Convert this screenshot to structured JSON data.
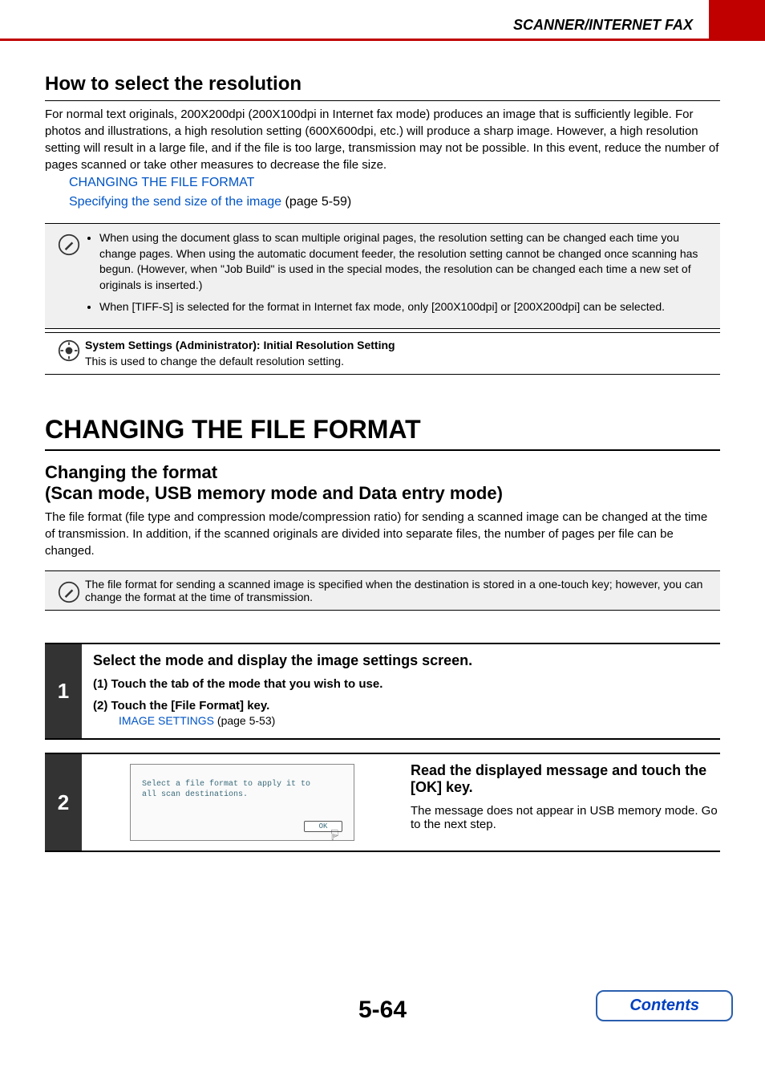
{
  "header": {
    "title": "SCANNER/INTERNET FAX"
  },
  "section1": {
    "heading": "How to select the resolution",
    "body": "For normal text originals, 200X200dpi (200X100dpi in Internet fax mode) produces an image that is sufficiently legible. For photos and illustrations, a high resolution setting (600X600dpi, etc.) will produce a sharp image. However, a high resolution setting will result in a large file, and if the file is too large, transmission may not be possible. In this event, reduce the number of pages scanned or take other measures to decrease the file size.",
    "link1": "CHANGING THE FILE FORMAT",
    "link2_text": "Specifying the send size of the image",
    "link2_page": " (page 5-59)"
  },
  "notebox": {
    "bullet1": "When using the document glass to scan multiple original pages, the resolution setting can be changed each time you change pages. When using the automatic document feeder, the resolution setting cannot be changed once scanning has begun. (However, when \"Job Build\" is used in the special modes, the resolution can be changed each time a new set of originals is inserted.)",
    "bullet2": "When [TIFF-S] is selected for the format in Internet fax mode, only [200X100dpi] or [200X200dpi] can be selected."
  },
  "adminbox": {
    "title": "System Settings (Administrator): Initial Resolution Setting",
    "body": "This is used to change the default resolution setting."
  },
  "main": {
    "h1": "CHANGING THE FILE FORMAT",
    "h2_line1": "Changing the format",
    "h2_line2": "(Scan mode, USB memory mode and Data entry mode)",
    "body": "The file format (file type and compression mode/compression ratio) for sending a scanned image can be changed at the time of transmission. In addition, if the scanned originals are divided into separate files, the number of pages per file can be changed."
  },
  "note2": {
    "body": "The file format for sending a scanned image is specified when the destination is stored in a one-touch key; however, you can change the format at the time of transmission."
  },
  "step1": {
    "num": "1",
    "title": "Select the mode and display the image settings screen.",
    "sub1": "(1)  Touch the tab of the mode that you wish to use.",
    "sub2": "(2)  Touch the [File Format] key.",
    "link_text": "IMAGE SETTINGS",
    "link_page": " (page 5-53)"
  },
  "step2": {
    "num": "2",
    "screen_msg_line1": "Select a file format to apply it to",
    "screen_msg_line2": "all scan destinations.",
    "ok_label": "OK",
    "title": "Read the displayed message and touch the [OK] key.",
    "body": "The message does not appear in USB memory mode. Go to the next step."
  },
  "footer": {
    "page_number": "5-64",
    "contents_label": "Contents"
  }
}
